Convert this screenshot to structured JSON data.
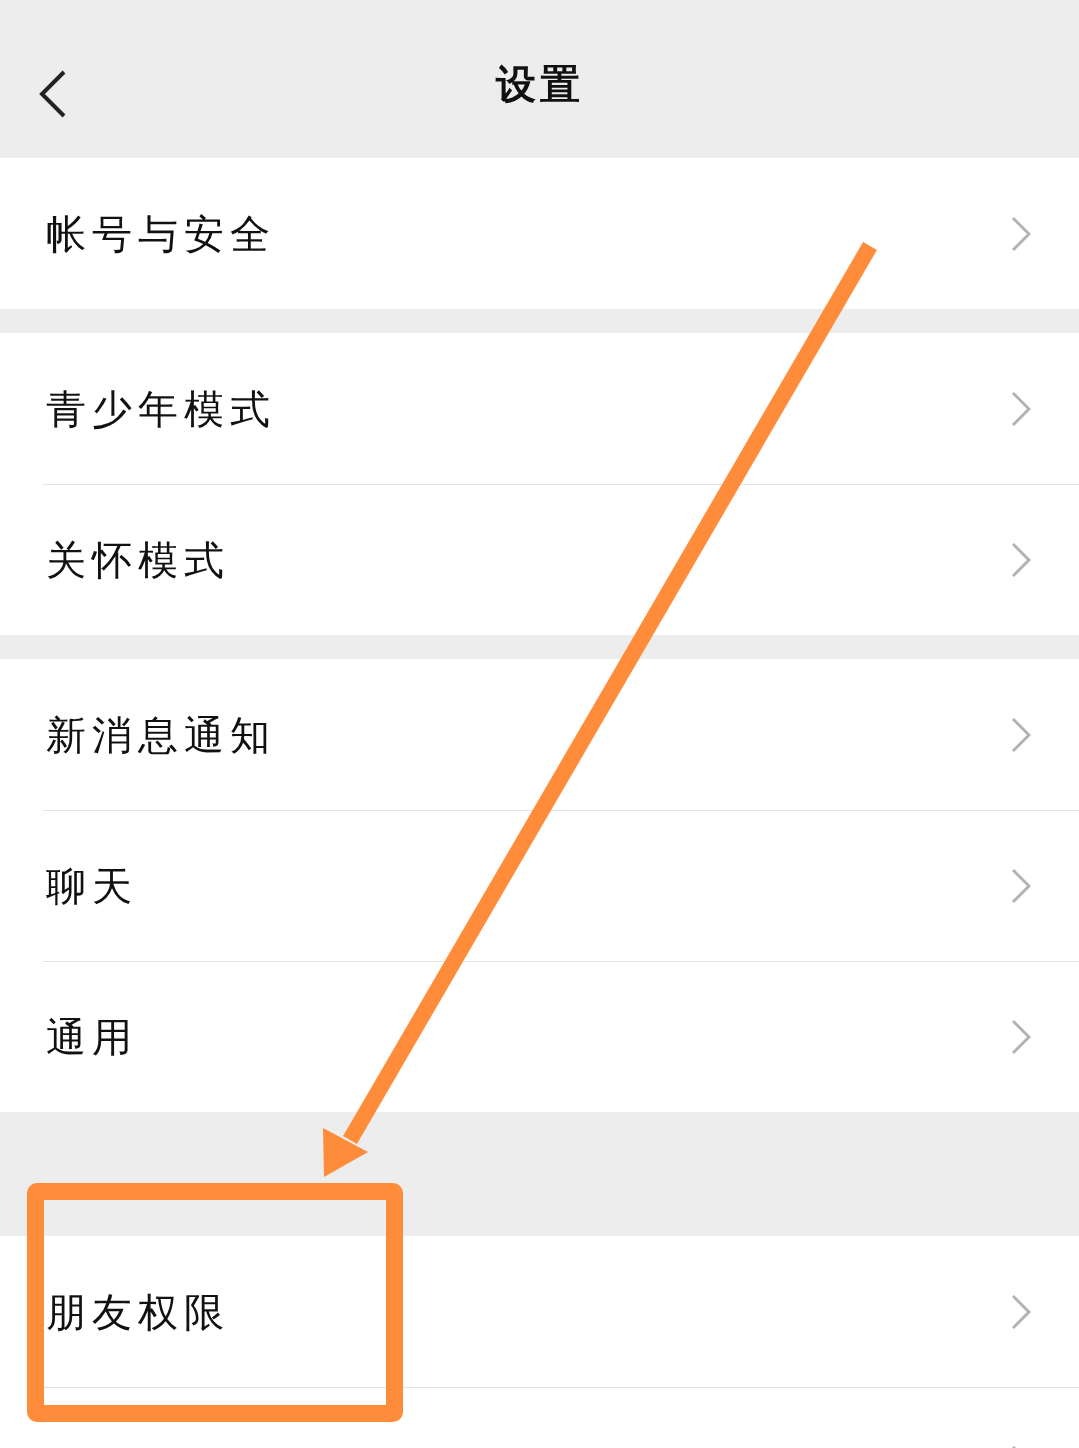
{
  "nav": {
    "title": "设置"
  },
  "groups": [
    {
      "items": [
        {
          "label": "帐号与安全"
        }
      ]
    },
    {
      "items": [
        {
          "label": "青少年模式"
        },
        {
          "label": "关怀模式"
        }
      ]
    },
    {
      "items": [
        {
          "label": "新消息通知"
        },
        {
          "label": "聊天"
        },
        {
          "label": "通用"
        }
      ]
    },
    {
      "items": [
        {
          "label": "朋友权限"
        }
      ],
      "more_below": true
    }
  ]
}
